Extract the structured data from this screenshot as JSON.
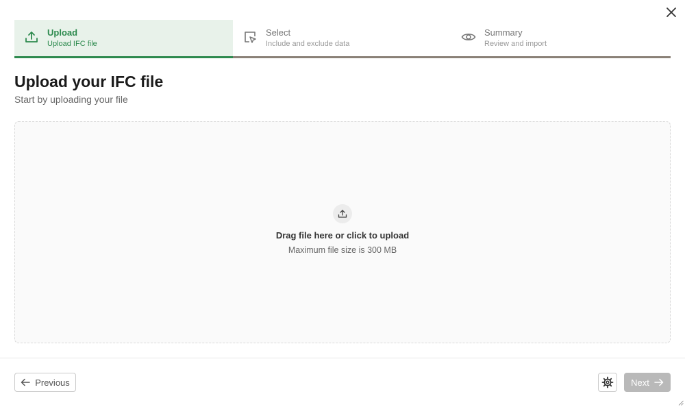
{
  "dialog": {
    "close_icon": "close-icon"
  },
  "steps": [
    {
      "label": "Upload",
      "description": "Upload IFC file",
      "icon": "upload-icon",
      "active": true
    },
    {
      "label": "Select",
      "description": "Include and exclude data",
      "icon": "cursor-select-icon",
      "active": false
    },
    {
      "label": "Summary",
      "description": "Review and import",
      "icon": "eye-icon",
      "active": false
    }
  ],
  "page": {
    "title": "Upload your IFC file",
    "subtitle": "Start by uploading your file"
  },
  "dropzone": {
    "icon": "upload-icon",
    "main_text": "Drag file here or click to upload",
    "sub_text": "Maximum file size is 300 MB"
  },
  "footer": {
    "previous_label": "Previous",
    "next_label": "Next",
    "next_enabled": false,
    "settings_icon": "gear-icon"
  },
  "colors": {
    "accent": "#2d8a4e",
    "active_step_bg": "#e8f2ea",
    "inactive_bar": "#8a8177",
    "disabled_button": "#b9b9b9"
  }
}
